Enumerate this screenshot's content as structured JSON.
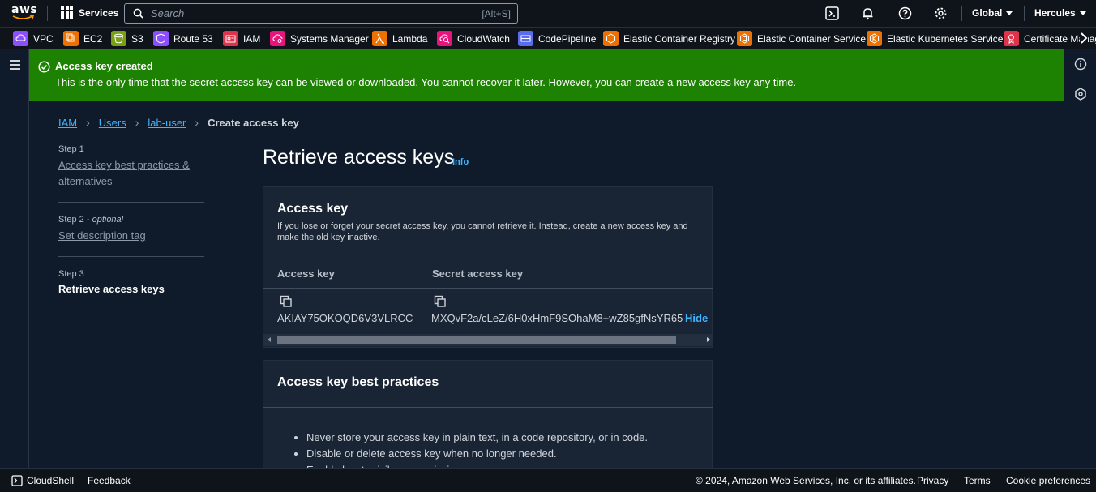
{
  "topnav": {
    "logo_text": "aws",
    "services_label": "Services",
    "search_placeholder": "Search",
    "search_shortcut": "[Alt+S]",
    "region": "Global",
    "account": "Hercules"
  },
  "favorites": [
    {
      "label": "VPC",
      "color": "#8c4fff"
    },
    {
      "label": "EC2",
      "color": "#ed7100"
    },
    {
      "label": "S3",
      "color": "#7aa116"
    },
    {
      "label": "Route 53",
      "color": "#8c4fff"
    },
    {
      "label": "IAM",
      "color": "#dd344c"
    },
    {
      "label": "Systems Manager",
      "color": "#e7157b"
    },
    {
      "label": "Lambda",
      "color": "#ed7100"
    },
    {
      "label": "CloudWatch",
      "color": "#e7157b"
    },
    {
      "label": "CodePipeline",
      "color": "#5a6cf0"
    },
    {
      "label": "Elastic Container Registry",
      "color": "#ed7100"
    },
    {
      "label": "Elastic Container Service",
      "color": "#ed7100"
    },
    {
      "label": "Elastic Kubernetes Service",
      "color": "#ed7100"
    },
    {
      "label": "Certificate Manager",
      "color": "#dd344c"
    }
  ],
  "flash": {
    "title": "Access key created",
    "message": "This is the only time that the secret access key can be viewed or downloaded. You cannot recover it later. However, you can create a new access key any time."
  },
  "breadcrumb": {
    "items": [
      "IAM",
      "Users",
      "lab-user"
    ],
    "current": "Create access key"
  },
  "steps": {
    "step1_label": "Step 1",
    "step1_title": "Access key best practices & alternatives",
    "step2_label": "Step 2 - ",
    "step2_optional": "optional",
    "step2_title": "Set description tag",
    "step3_label": "Step 3",
    "step3_title": "Retrieve access keys"
  },
  "page": {
    "title": "Retrieve access keys",
    "info_link": "Info"
  },
  "access_key_card": {
    "heading": "Access key",
    "description": "If you lose or forget your secret access key, you cannot retrieve it. Instead, create a new access key and make the old key inactive.",
    "col_access_key": "Access key",
    "col_secret_key": "Secret access key",
    "access_key_value": "AKIAY75OKOQD6V3VLRCC",
    "secret_key_value": "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",
    "hide_label": "Hide"
  },
  "best_practices_card": {
    "heading": "Access key best practices",
    "items": [
      "Never store your access key in plain text, in a code repository, or in code.",
      "Disable or delete access key when no longer needed.",
      "Enable least-privilege permissions."
    ]
  },
  "footer": {
    "cloudshell": "CloudShell",
    "feedback": "Feedback",
    "copyright": "© 2024, Amazon Web Services, Inc. or its affiliates.",
    "privacy": "Privacy",
    "terms": "Terms",
    "cookies": "Cookie preferences"
  }
}
